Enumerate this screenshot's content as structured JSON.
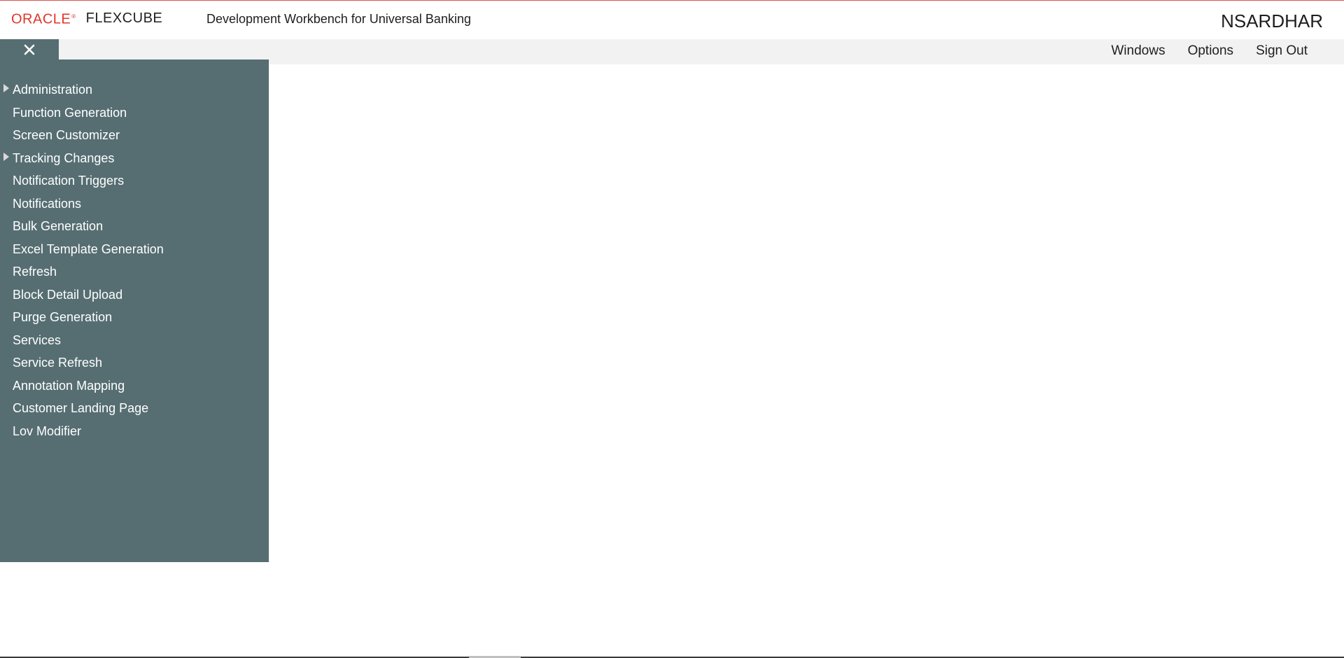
{
  "header": {
    "logo_oracle": "ORACLE",
    "logo_reg": "®",
    "logo_product": "FLEXCUBE",
    "app_title": "Development Workbench for Universal Banking",
    "user_name": "NSARDHAR"
  },
  "toolbar": {
    "close_icon": "close-icon",
    "nav": [
      {
        "label": "Windows"
      },
      {
        "label": "Options"
      },
      {
        "label": "Sign Out"
      }
    ]
  },
  "sidebar": {
    "items": [
      {
        "label": "Administration",
        "expandable": true
      },
      {
        "label": "Function Generation",
        "expandable": false
      },
      {
        "label": "Screen Customizer",
        "expandable": false
      },
      {
        "label": "Tracking Changes",
        "expandable": true
      },
      {
        "label": "Notification Triggers",
        "expandable": false
      },
      {
        "label": "Notifications",
        "expandable": false
      },
      {
        "label": "Bulk Generation",
        "expandable": false
      },
      {
        "label": "Excel Template Generation",
        "expandable": false
      },
      {
        "label": "Refresh",
        "expandable": false
      },
      {
        "label": "Block Detail Upload",
        "expandable": false
      },
      {
        "label": "Purge Generation",
        "expandable": false
      },
      {
        "label": "Services",
        "expandable": false
      },
      {
        "label": "Service Refresh",
        "expandable": false
      },
      {
        "label": "Annotation Mapping",
        "expandable": false
      },
      {
        "label": "Customer Landing Page",
        "expandable": false
      },
      {
        "label": "Lov Modifier",
        "expandable": false
      }
    ]
  },
  "colors": {
    "brand_red": "#e0362a",
    "sidebar_bg": "#566e72",
    "toolbar_bg": "#f2f2f2",
    "menu_text": "#ffffff"
  }
}
